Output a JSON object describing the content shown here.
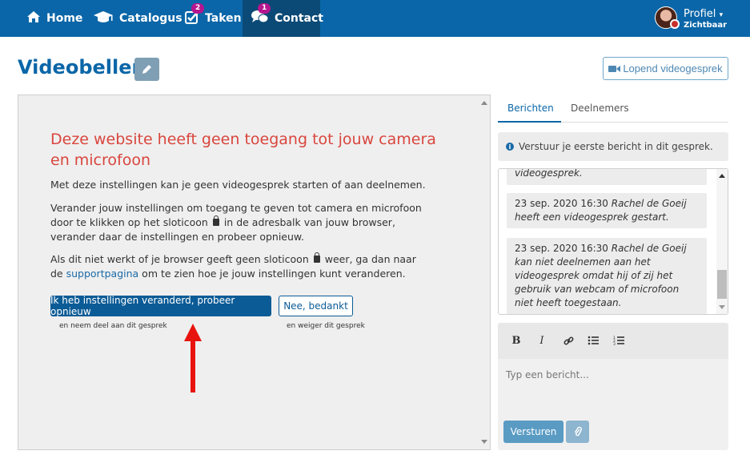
{
  "nav": {
    "items": [
      {
        "label": "Home",
        "icon": "home-icon"
      },
      {
        "label": "Catalogus",
        "icon": "graduation-cap-icon"
      },
      {
        "label": "Taken",
        "icon": "checkbox-icon",
        "badge": "2"
      },
      {
        "label": "Contact",
        "icon": "chat-bubbles-icon",
        "badge": "1"
      }
    ],
    "profile_name": "Profiel",
    "profile_status": "Zichtbaar"
  },
  "page": {
    "title": "Videobellen",
    "lopend_label": "Lopend videogesprek"
  },
  "video": {
    "warning_title": "Deze website heeft geen toegang tot jouw camera en microfoon",
    "p1": "Met deze instellingen kan je geen videogesprek starten of aan deelnemen.",
    "p2_a": "Verander jouw instellingen om toegang te geven tot camera en microfoon door te klikken op het sloticoon",
    "p2_b": "in de adresbalk van jouw browser, verander daar de instellingen en probeer opnieuw.",
    "p3_a": "Als dit niet werkt of je browser geeft geen sloticoon",
    "p3_b": "weer, ga dan naar de",
    "p3_link": "supportpagina",
    "p3_c": "om te zien hoe je jouw instellingen kunt veranderen.",
    "retry_label": "Ik heb instellingen veranderd, probeer opnieuw",
    "decline_label": "Nee, bedankt",
    "retry_hint": "en neem deel aan dit gesprek",
    "decline_hint": "en weiger dit gesprek"
  },
  "sidebar": {
    "tabs": [
      "Berichten",
      "Deelnemers"
    ],
    "info": "Verstuur je eerste bericht in dit gesprek.",
    "messages": [
      {
        "meta": "",
        "text": "videogesprek."
      },
      {
        "meta": "23 sep. 2020 16:30",
        "text": "Rachel de Goeij heeft een videogesprek gestart."
      },
      {
        "meta": "23 sep. 2020 16:30",
        "text": "Rachel de Goeij kan niet deelnemen aan het videogesprek omdat hij of zij het gebruik van webcam of microfoon niet heeft toegestaan."
      }
    ],
    "placeholder": "Typ een bericht...",
    "send_label": "Versturen"
  }
}
